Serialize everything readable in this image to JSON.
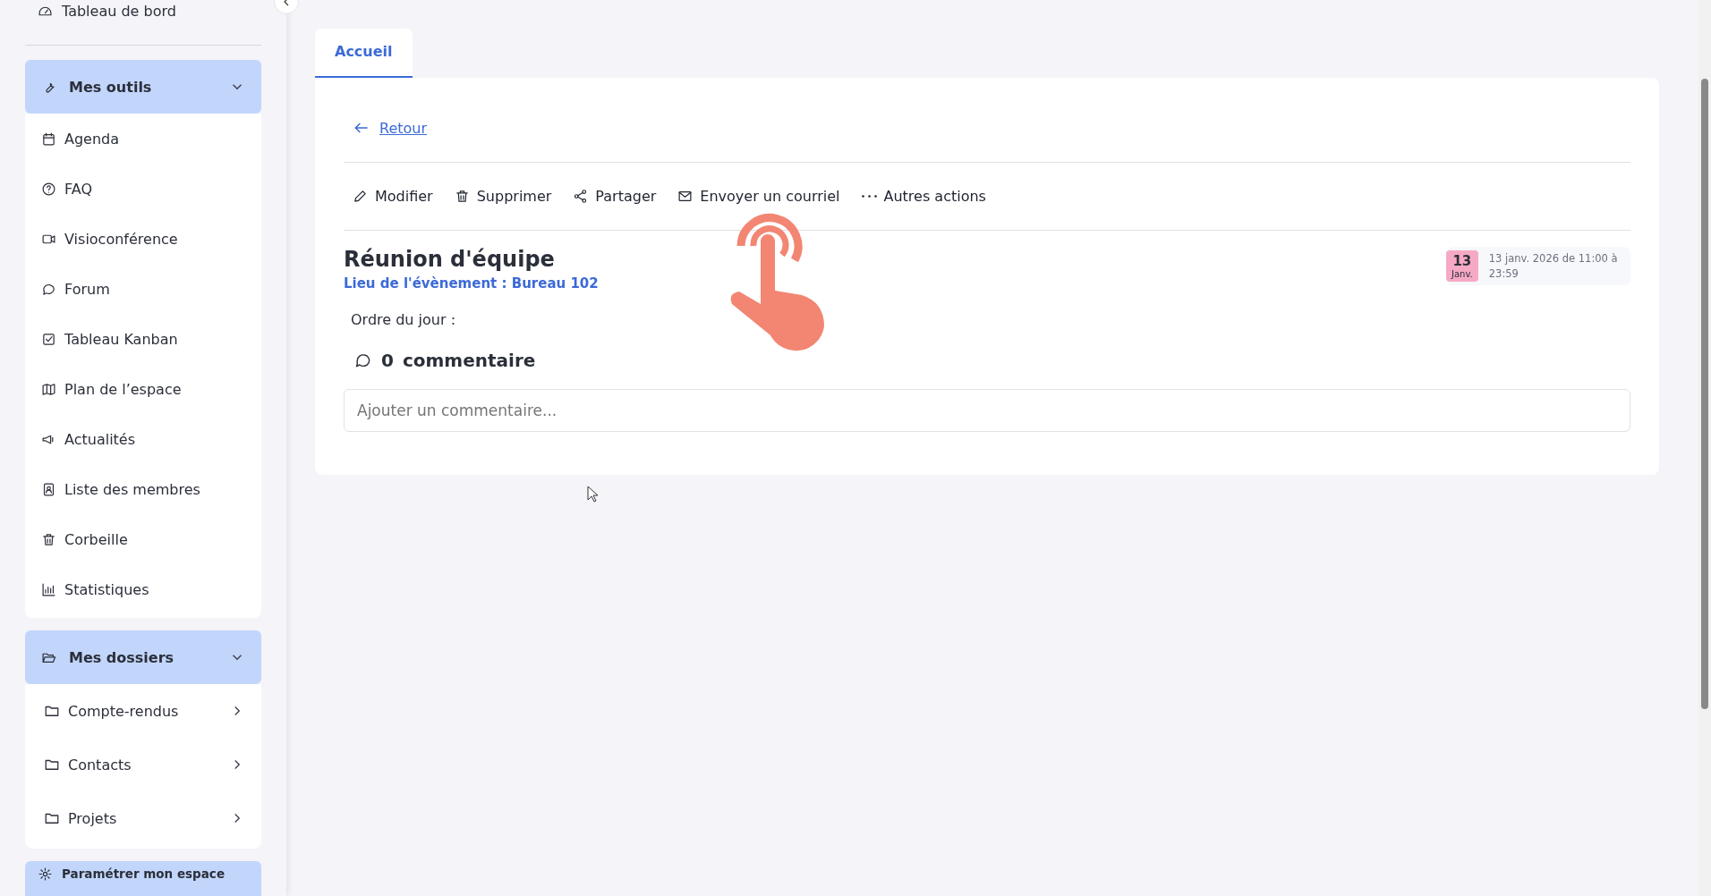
{
  "sidebar": {
    "top_item": {
      "label": "Tableau de bord"
    },
    "sections": [
      {
        "title": "Mes outils",
        "expanded": true,
        "items": [
          {
            "label": "Agenda",
            "kind": "link"
          },
          {
            "label": "FAQ",
            "kind": "link"
          },
          {
            "label": "Visioconférence",
            "kind": "link"
          },
          {
            "label": "Forum",
            "kind": "link"
          },
          {
            "label": "Tableau Kanban",
            "kind": "link"
          },
          {
            "label": "Plan de l’espace",
            "kind": "link"
          },
          {
            "label": "Actualités",
            "kind": "link"
          },
          {
            "label": "Liste des membres",
            "kind": "link"
          },
          {
            "label": "Corbeille",
            "kind": "link"
          },
          {
            "label": "Statistiques",
            "kind": "link"
          }
        ]
      },
      {
        "title": "Mes dossiers",
        "expanded": true,
        "items": [
          {
            "label": "Compte-rendus",
            "kind": "folder"
          },
          {
            "label": "Contacts",
            "kind": "folder"
          },
          {
            "label": "Projets",
            "kind": "folder"
          }
        ]
      },
      {
        "title": "Paramétrer mon espace",
        "expanded": false
      }
    ]
  },
  "tabs": [
    {
      "label": "Accueil",
      "selected": true
    }
  ],
  "back_link": "Retour",
  "actions": [
    "Modifier",
    "Supprimer",
    "Partager",
    "Envoyer un courriel",
    "Autres actions"
  ],
  "event": {
    "title": "Réunion d'équipe",
    "location": "Lieu de l'évènement : Bureau 102",
    "day": "13",
    "month": "Janv.",
    "when": "13 janv. 2026 de 11:00 à 23:59",
    "agenda_label": "Ordre du jour :"
  },
  "comments": {
    "count": "0",
    "label": "commentaire",
    "placeholder": "Ajouter un commentaire..."
  }
}
